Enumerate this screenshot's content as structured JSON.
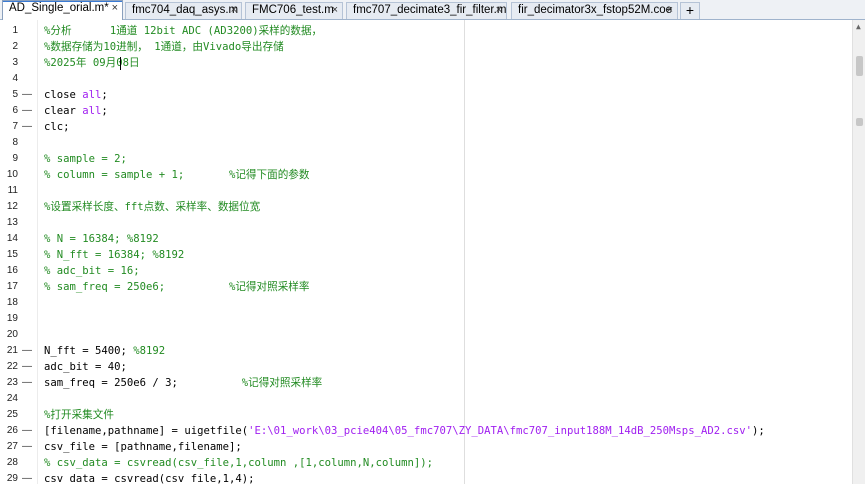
{
  "tabs": [
    {
      "label": "AD_Single_orial.m*",
      "active": true
    },
    {
      "label": "fmc704_daq_asys.m"
    },
    {
      "label": "FMC706_test.m"
    },
    {
      "label": "fmc707_decimate3_fir_filter.m"
    },
    {
      "label": "fir_decimator3x_fstop52M.coe"
    }
  ],
  "tab_add_label": "+",
  "lines": [
    {
      "n": "1",
      "m": "",
      "segs": [
        {
          "t": "%分析      1通道 12bit ADC (AD3200)采样的数据，",
          "c": "cm"
        }
      ]
    },
    {
      "n": "2",
      "m": "",
      "segs": [
        {
          "t": "%数据存储为10进制， 1通道，由Vivado导出存储",
          "c": "cm"
        }
      ]
    },
    {
      "n": "3",
      "m": "",
      "segs": [
        {
          "t": "%2025年 09月08日",
          "c": "cm"
        }
      ]
    },
    {
      "n": "4",
      "m": "",
      "segs": []
    },
    {
      "n": "5",
      "m": "—",
      "segs": [
        {
          "t": "close ",
          "c": ""
        },
        {
          "t": "all",
          "c": "kw"
        },
        {
          "t": ";",
          "c": ""
        }
      ]
    },
    {
      "n": "6",
      "m": "—",
      "segs": [
        {
          "t": "clear ",
          "c": ""
        },
        {
          "t": "all",
          "c": "kw"
        },
        {
          "t": ";",
          "c": ""
        }
      ]
    },
    {
      "n": "7",
      "m": "—",
      "segs": [
        {
          "t": "clc;",
          "c": ""
        }
      ]
    },
    {
      "n": "8",
      "m": "",
      "segs": []
    },
    {
      "n": "9",
      "m": "",
      "segs": [
        {
          "t": "% sample = 2;",
          "c": "cm"
        }
      ]
    },
    {
      "n": "10",
      "m": "",
      "segs": [
        {
          "t": "% column = sample + 1;       %记得下面的参数",
          "c": "cm"
        }
      ]
    },
    {
      "n": "11",
      "m": "",
      "segs": []
    },
    {
      "n": "12",
      "m": "",
      "segs": [
        {
          "t": "%设置采样长度、fft点数、采样率、数据位宽",
          "c": "cm"
        }
      ]
    },
    {
      "n": "13",
      "m": "",
      "segs": []
    },
    {
      "n": "14",
      "m": "",
      "segs": [
        {
          "t": "% N = 16384; %8192",
          "c": "cm"
        }
      ]
    },
    {
      "n": "15",
      "m": "",
      "segs": [
        {
          "t": "% N_fft = 16384; %8192",
          "c": "cm"
        }
      ]
    },
    {
      "n": "16",
      "m": "",
      "segs": [
        {
          "t": "% adc_bit = 16;",
          "c": "cm"
        }
      ]
    },
    {
      "n": "17",
      "m": "",
      "segs": [
        {
          "t": "% sam_freq = 250e6;          %记得对照采样率",
          "c": "cm"
        }
      ]
    },
    {
      "n": "18",
      "m": "",
      "segs": []
    },
    {
      "n": "19",
      "m": "",
      "segs": []
    },
    {
      "n": "20",
      "m": "",
      "segs": []
    },
    {
      "n": "21",
      "m": "—",
      "segs": [
        {
          "t": "N_fft = 5400; ",
          "c": ""
        },
        {
          "t": "%8192",
          "c": "cm"
        }
      ]
    },
    {
      "n": "22",
      "m": "—",
      "segs": [
        {
          "t": "adc_bit = 40;",
          "c": ""
        }
      ]
    },
    {
      "n": "23",
      "m": "—",
      "segs": [
        {
          "t": "sam_freq = 250e6 / 3;          ",
          "c": ""
        },
        {
          "t": "%记得对照采样率",
          "c": "cm"
        }
      ]
    },
    {
      "n": "24",
      "m": "",
      "segs": []
    },
    {
      "n": "25",
      "m": "",
      "segs": [
        {
          "t": "%打开采集文件",
          "c": "cm"
        }
      ]
    },
    {
      "n": "26",
      "m": "—",
      "segs": [
        {
          "t": "[filename,pathname] = uigetfile(",
          "c": ""
        },
        {
          "t": "'E:\\01_work\\03_pcie404\\05_fmc707\\ZY_DATA\\fmc707_input188M_14dB_250Msps_AD2.csv'",
          "c": "str"
        },
        {
          "t": ");",
          "c": ""
        }
      ]
    },
    {
      "n": "27",
      "m": "—",
      "segs": [
        {
          "t": "csv_file = [pathname,filename];",
          "c": ""
        }
      ]
    },
    {
      "n": "28",
      "m": "",
      "segs": [
        {
          "t": "% csv_data = csvread(csv_file,1,column ,[1,column,N,column]);",
          "c": "cm"
        }
      ]
    },
    {
      "n": "29",
      "m": "—",
      "segs": [
        {
          "t": "csv_data = csvread(csv_file,1,4);",
          "c": ""
        }
      ]
    }
  ]
}
